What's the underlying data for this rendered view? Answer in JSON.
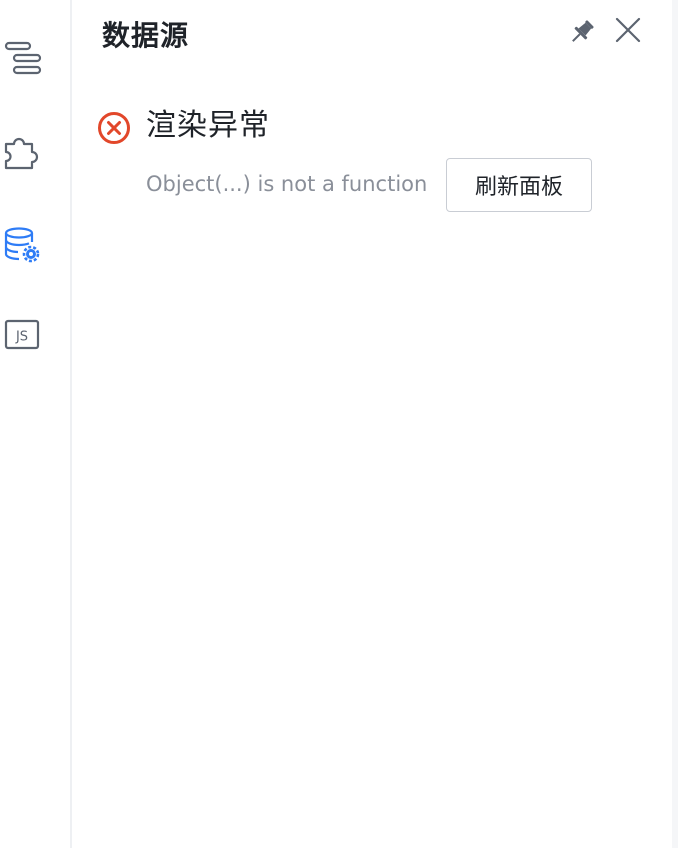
{
  "sidebar": {
    "items": [
      {
        "icon": "outline-tree-icon",
        "active": false
      },
      {
        "icon": "component-puzzle-icon",
        "active": false
      },
      {
        "icon": "datasource-gear-icon",
        "active": true
      },
      {
        "icon": "js-script-icon",
        "active": false,
        "label": "JS"
      }
    ]
  },
  "panel": {
    "title": "数据源",
    "pin_icon": "pin-icon",
    "close_icon": "close-icon"
  },
  "error": {
    "icon": "error-circle-icon",
    "title": "渲染异常",
    "message": "Object(...) is not a function",
    "refresh_label": "刷新面板"
  },
  "colors": {
    "active_icon": "#2e7cf6",
    "inactive_icon": "#5c6470",
    "error": "#e2472a",
    "title_text": "#1f2329",
    "secondary_text": "#8a8f99",
    "button_border": "#c9cdd4"
  }
}
